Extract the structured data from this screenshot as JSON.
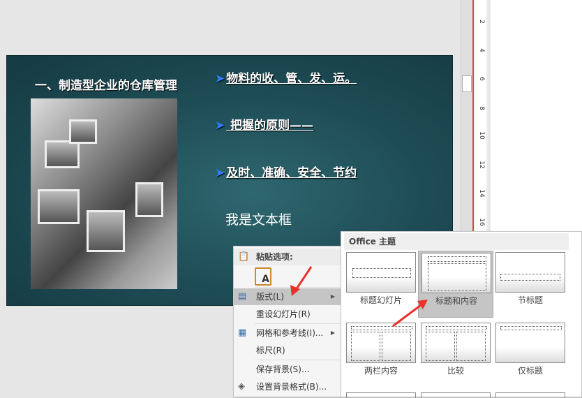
{
  "slide": {
    "title": "一、制造型企业的仓库管理",
    "bullets": [
      "物料的收、管、发、运。",
      "把握的原则——",
      "及时、准确、安全、节约"
    ],
    "bullet_marker": "➤",
    "textbox": "我是文本框"
  },
  "ruler": {
    "labels": [
      "2",
      "4",
      "6",
      "8",
      "10",
      "12",
      "14",
      "16"
    ]
  },
  "context_menu": {
    "paste_header": "粘贴选项:",
    "items": [
      {
        "label": "版式(L)",
        "icon": "layout-icon",
        "submenu": true
      },
      {
        "label": "重设幻灯片(R)"
      },
      {
        "label": "网格和参考线(I)...",
        "icon": "grid-icon",
        "submenu": true
      },
      {
        "label": "标尺(R)"
      },
      {
        "label": "保存背景(S)..."
      },
      {
        "label": "设置背景格式(B)...",
        "icon": "format-background-icon"
      }
    ]
  },
  "layout_menu": {
    "header": "Office 主题",
    "layouts": [
      "标题幻灯片",
      "标题和内容",
      "节标题",
      "两栏内容",
      "比较",
      "仅标题"
    ],
    "selected": "标题和内容"
  },
  "colors": {
    "slide_bg": "#1e4c55",
    "arrow": "#e8322b",
    "highlight": "#c5c5c5"
  }
}
